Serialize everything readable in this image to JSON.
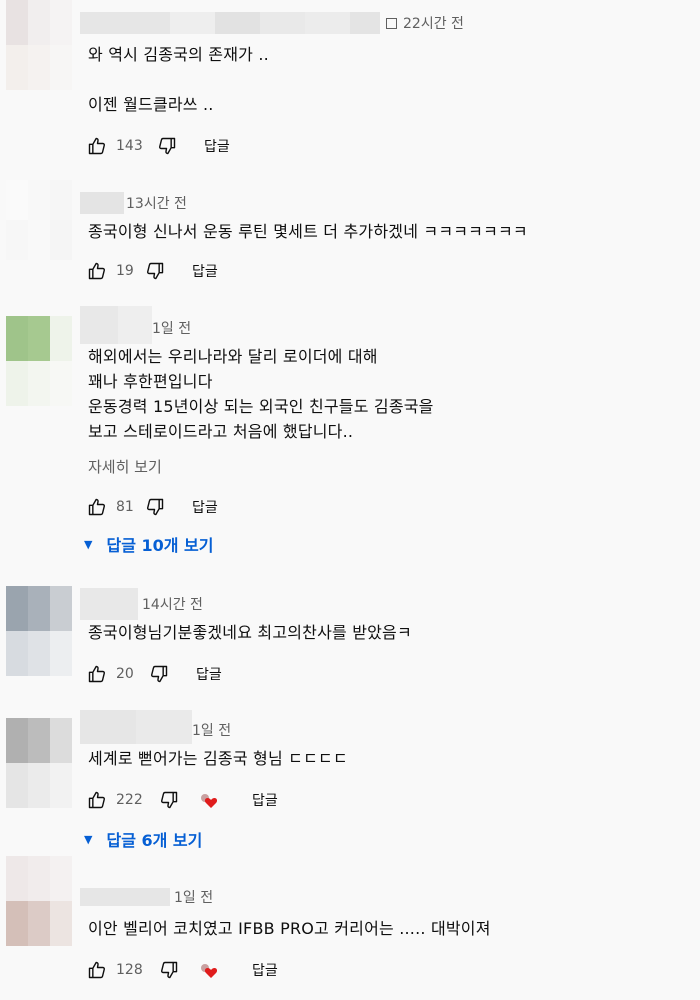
{
  "comments": [
    {
      "time": "22시간 전",
      "text": "와 역시 김종국의 존재가 ..\n\n이젠 월드클라쓰 ..",
      "likes": "143",
      "reply_label": "답글"
    },
    {
      "time": "13시간 전",
      "text": "종국이형 신나서 운동 루틴 몇세트 더 추가하겠네 ㅋㅋㅋㅋㅋㅋㅋ",
      "likes": "19",
      "reply_label": "답글"
    },
    {
      "time": "1일 전",
      "text": "해외에서는 우리나라와 달리 로이더에 대해\n꽤나 후한편입니다\n운동경력 15년이상 되는 외국인 친구들도 김종국을\n보고 스테로이드라고 처음에 했답니다..",
      "more_label": "자세히 보기",
      "likes": "81",
      "reply_label": "답글",
      "replies_label": "답글 10개 보기"
    },
    {
      "time": "14시간 전",
      "text": "종국이형님기분좋겠네요 최고의찬사를 받았음ㅋ",
      "likes": "20",
      "reply_label": "답글"
    },
    {
      "time": "1일 전",
      "text": "세계로 뻗어가는 김종국 형님 ㄷㄷㄷㄷ",
      "likes": "222",
      "reply_label": "답글",
      "replies_label": "답글 6개 보기"
    },
    {
      "time": "1일 전",
      "text": "이안 벨리어 코치였고 IFBB PRO고 커리어는 ..... 대박이져",
      "likes": "128",
      "reply_label": "답글"
    }
  ],
  "icons": {
    "like": "thumb-up-icon",
    "dislike": "thumb-down-icon",
    "creator_heart": "creator-heart-icon",
    "expand": "caret-down-icon"
  },
  "colors": {
    "link": "#065fd4",
    "meta": "#606060",
    "heart": "#e01c1c"
  }
}
